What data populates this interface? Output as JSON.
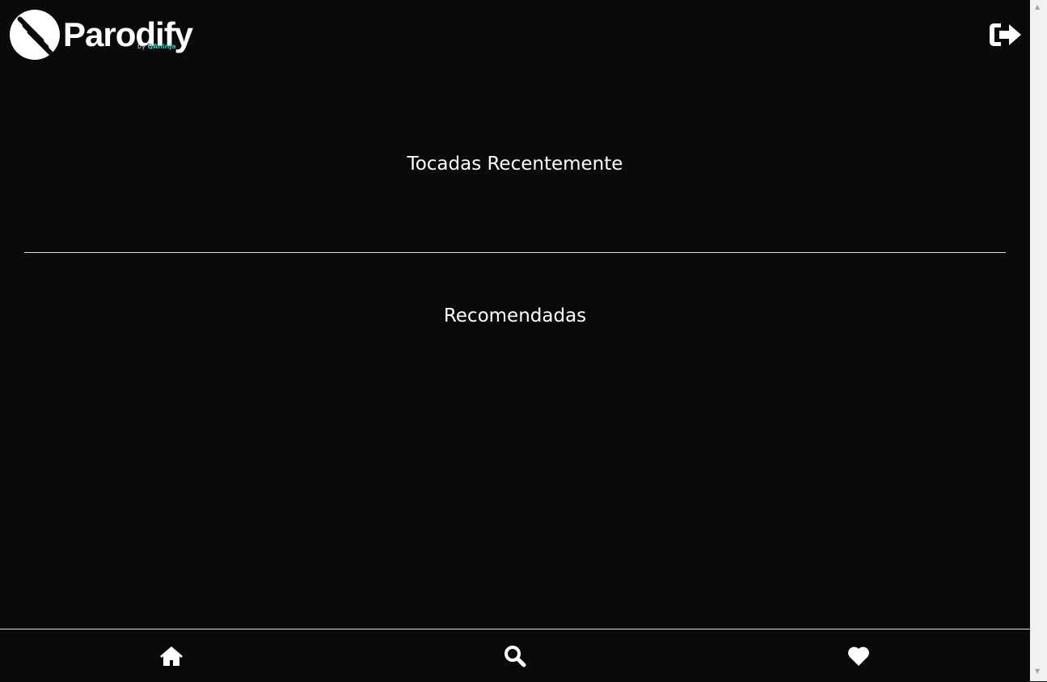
{
  "header": {
    "brand": "Parodify",
    "byline": "by",
    "byline_brand": "QAninja",
    "logout_icon": "sign-out-icon"
  },
  "sections": [
    {
      "title": "Tocadas Recentemente"
    },
    {
      "title": "Recomendadas"
    }
  ],
  "nav": [
    {
      "icon": "home-icon"
    },
    {
      "icon": "search-icon"
    },
    {
      "icon": "heart-icon"
    }
  ]
}
